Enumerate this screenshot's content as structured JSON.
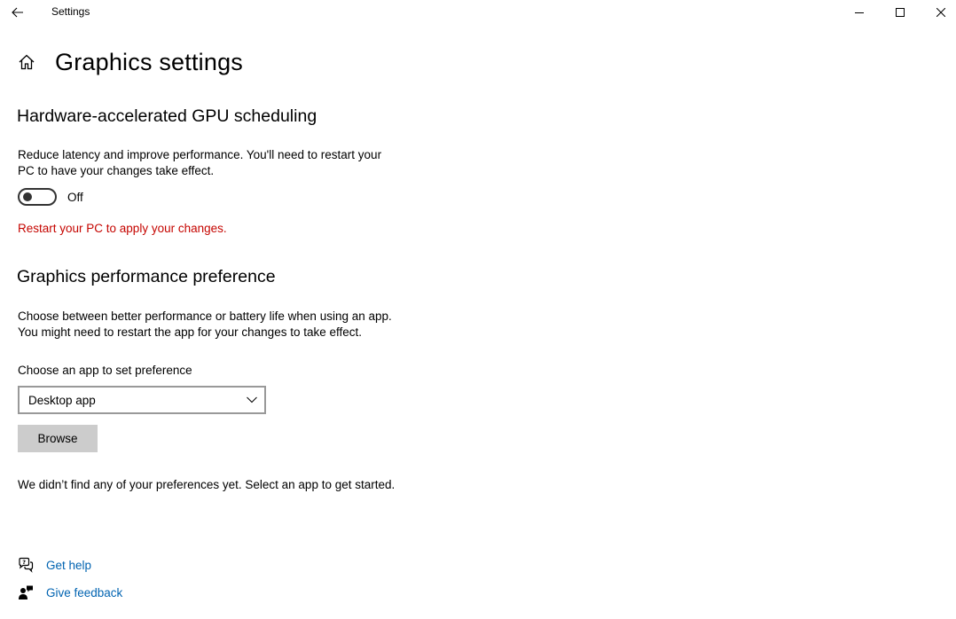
{
  "window": {
    "title": "Settings",
    "back_icon": "arrow-left",
    "minimize_icon": "minimize",
    "maximize_icon": "maximize",
    "close_icon": "close"
  },
  "page": {
    "title": "Graphics settings",
    "home_icon": "home"
  },
  "gpu_scheduling": {
    "heading": "Hardware-accelerated GPU scheduling",
    "description_line1": "Reduce latency and improve performance. You'll need to restart your",
    "description_line2": "PC to have your changes take effect.",
    "toggle_state": "Off",
    "toggle_on": false,
    "warning": "Restart your PC to apply your changes.",
    "warning_color": "#c50500"
  },
  "performance_preference": {
    "heading": "Graphics performance preference",
    "description_line1": "Choose between better performance or battery life when using an app.",
    "description_line2": "You might need to restart the app for your changes to take effect.",
    "choose_label": "Choose an app to set preference",
    "selected_app_type": "Desktop app",
    "browse_label": "Browse",
    "empty_message": "We didn’t find any of your preferences yet. Select an app to get started."
  },
  "footer_links": {
    "help_label": "Get help",
    "help_icon": "help-chat",
    "feedback_label": "Give feedback",
    "feedback_icon": "feedback-person",
    "link_color": "#0063b1"
  }
}
